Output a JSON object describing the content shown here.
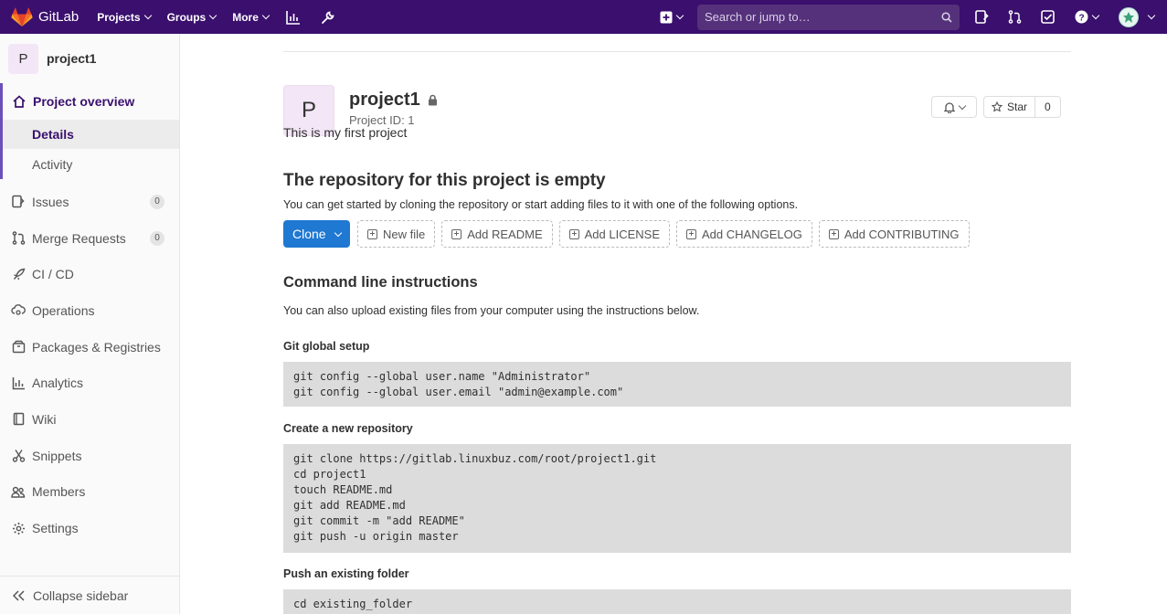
{
  "navbar": {
    "brand": "GitLab",
    "menu": [
      "Projects",
      "Groups",
      "More"
    ],
    "search_placeholder": "Search or jump to…"
  },
  "sidebar": {
    "project_initial": "P",
    "project_name": "project1",
    "overview": "Project overview",
    "details": "Details",
    "activity": "Activity",
    "items": [
      {
        "label": "Issues",
        "icon": "issues-icon",
        "count": "0"
      },
      {
        "label": "Merge Requests",
        "icon": "merge-request-icon",
        "count": "0"
      },
      {
        "label": "CI / CD",
        "icon": "rocket-icon"
      },
      {
        "label": "Operations",
        "icon": "cloud-gear-icon"
      },
      {
        "label": "Packages & Registries",
        "icon": "package-icon"
      },
      {
        "label": "Analytics",
        "icon": "chart-icon"
      },
      {
        "label": "Wiki",
        "icon": "book-icon"
      },
      {
        "label": "Snippets",
        "icon": "scissors-icon"
      },
      {
        "label": "Members",
        "icon": "users-icon"
      },
      {
        "label": "Settings",
        "icon": "gear-icon"
      }
    ],
    "collapse": "Collapse sidebar"
  },
  "project": {
    "initial": "P",
    "title": "project1",
    "id": "Project ID: 1",
    "star_label": "Star",
    "star_count": "0",
    "description": "This is my first project"
  },
  "empty": {
    "heading": "The repository for this project is empty",
    "subtext": "You can get started by cloning the repository or start adding files to it with one of the following options.",
    "clone": "Clone",
    "buttons": [
      "New file",
      "Add README",
      "Add LICENSE",
      "Add CHANGELOG",
      "Add CONTRIBUTING"
    ]
  },
  "cli": {
    "heading": "Command line instructions",
    "intro": "You can also upload existing files from your computer using the instructions below.",
    "global_heading": "Git global setup",
    "global_code": "git config --global user.name \"Administrator\"\ngit config --global user.email \"admin@example.com\"",
    "new_heading": "Create a new repository",
    "new_code": "git clone https://gitlab.linuxbuz.com/root/project1.git\ncd project1\ntouch README.md\ngit add README.md\ngit commit -m \"add README\"\ngit push -u origin master",
    "push_heading": "Push an existing folder",
    "push_code": "cd existing_folder"
  }
}
